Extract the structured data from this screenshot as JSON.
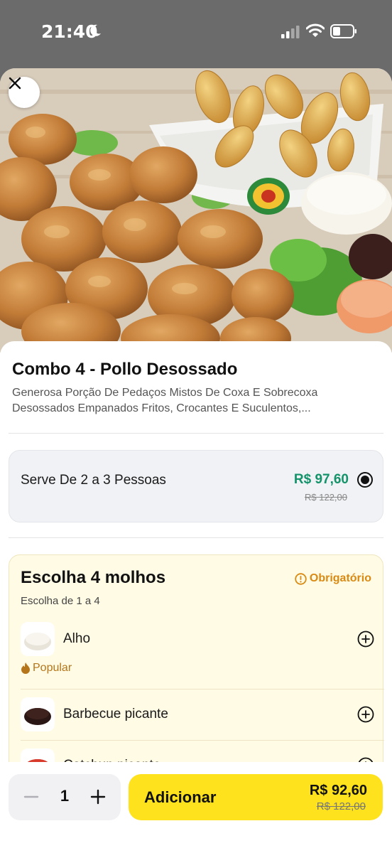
{
  "status": {
    "time": "21:40"
  },
  "product": {
    "title": "Combo 4 - Pollo Desossado",
    "description": "Generosa Porção De Pedaços Mistos De Coxa E Sobrecoxa Desossados Empanados Fritos, Crocantes E Suculentos,..."
  },
  "size_option": {
    "label": "Serve De 2 a 3 Pessoas",
    "price": "R$ 97,60",
    "old_price": "R$ 122,00",
    "selected": true
  },
  "sauces": {
    "title": "Escolha 4 molhos",
    "required_label": "Obrigatório",
    "subtitle": "Escolha de 1 a 4",
    "items": [
      {
        "name": "Alho",
        "badge": "Popular"
      },
      {
        "name": "Barbecue picante"
      },
      {
        "name": "Catchup picante"
      }
    ]
  },
  "footer": {
    "quantity": "1",
    "add_label": "Adicionar",
    "price": "R$ 92,60",
    "old_price": "R$ 122,00"
  },
  "colors": {
    "accent_yellow": "#fde21d",
    "price_green": "#14936a",
    "required_orange": "#d98a14"
  },
  "icons": [
    "moon-icon",
    "signal-icon",
    "wifi-icon",
    "battery-icon",
    "close-icon",
    "alert-circle-icon",
    "flame-icon",
    "plus-circle-icon",
    "minus-icon",
    "plus-icon"
  ]
}
